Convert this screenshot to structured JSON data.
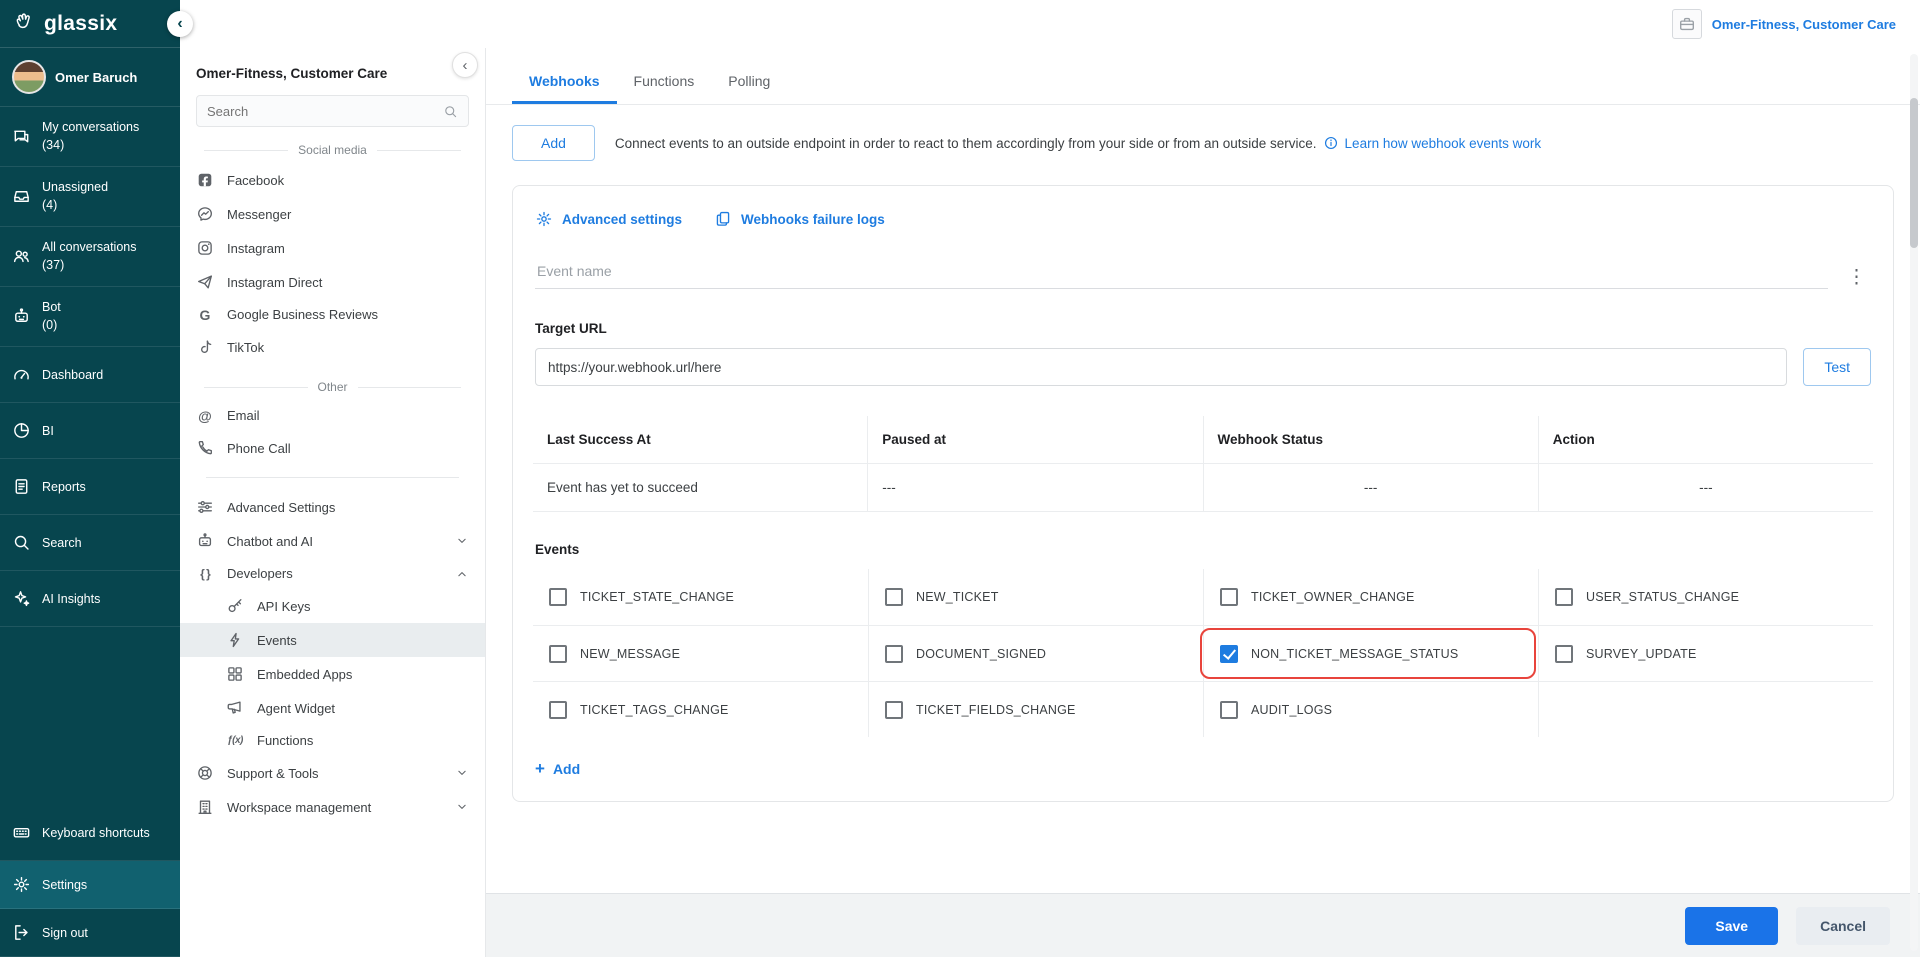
{
  "colors": {
    "teal_dark": "#07454e",
    "teal_active": "#11616f",
    "accent_blue": "#1e7ce0",
    "save_blue": "#1a73e8",
    "highlight_red": "#e8443c",
    "border_gray": "#e4e6e8"
  },
  "glyphs": {
    "plus": "+",
    "kebab": "⋮",
    "collapse": "‹",
    "google": "G",
    "email": "@",
    "code": "{ }",
    "function": "ƒ(x)"
  },
  "brand": {
    "logo_text": "glassix"
  },
  "top_bar": {
    "account_name": "Omer-Fitness, Customer Care"
  },
  "nav": {
    "user_name": "Omer Baruch",
    "items": [
      {
        "label": "My conversations",
        "count": "(34)",
        "icon": "chat-icon"
      },
      {
        "label": "Unassigned",
        "count": "(4)",
        "icon": "inbox-icon"
      },
      {
        "label": "All conversations",
        "count": "(37)",
        "icon": "people-icon"
      },
      {
        "label": "Bot",
        "count": "(0)",
        "icon": "bot-icon"
      },
      {
        "label": "Dashboard",
        "icon": "dashboard-icon"
      },
      {
        "label": "BI",
        "icon": "pie-chart-icon"
      },
      {
        "label": "Reports",
        "icon": "report-icon"
      },
      {
        "label": "Search",
        "icon": "search-icon"
      },
      {
        "label": "AI Insights",
        "icon": "sparkle-icon"
      }
    ],
    "bottom_items": [
      {
        "label": "Keyboard shortcuts",
        "icon": "keyboard-icon"
      },
      {
        "label": "Settings",
        "icon": "gear-icon",
        "active": true
      },
      {
        "label": "Sign out",
        "icon": "sign-out-icon"
      }
    ]
  },
  "settings_panel": {
    "title": "Omer-Fitness, Customer Care",
    "search_placeholder": "Search",
    "sections": {
      "social": "Social media",
      "other": "Other"
    },
    "social_items": [
      {
        "label": "Facebook",
        "icon": "facebook-icon"
      },
      {
        "label": "Messenger",
        "icon": "messenger-icon"
      },
      {
        "label": "Instagram",
        "icon": "instagram-icon"
      },
      {
        "label": "Instagram Direct",
        "icon": "instagram-direct-icon"
      },
      {
        "label": "Google Business Reviews",
        "icon": "google-icon"
      },
      {
        "label": "TikTok",
        "icon": "tiktok-icon"
      }
    ],
    "other_items": [
      {
        "label": "Email",
        "icon": "email-icon"
      },
      {
        "label": "Phone Call",
        "icon": "phone-icon"
      }
    ],
    "advanced_settings": "Advanced Settings",
    "groups": {
      "chatbot": "Chatbot and AI",
      "developers": "Developers",
      "support": "Support & Tools",
      "workspace": "Workspace management"
    },
    "developer_items": [
      {
        "label": "API Keys",
        "icon": "key-icon",
        "selected": false
      },
      {
        "label": "Events",
        "icon": "bolt-icon",
        "selected": true
      },
      {
        "label": "Embedded Apps",
        "icon": "grid-icon",
        "selected": false
      },
      {
        "label": "Agent Widget",
        "icon": "megaphone-icon",
        "selected": false
      },
      {
        "label": "Functions",
        "icon": "function-icon",
        "selected": false
      }
    ]
  },
  "main": {
    "tabs": [
      {
        "label": "Webhooks",
        "active": true
      },
      {
        "label": "Functions",
        "active": false
      },
      {
        "label": "Polling",
        "active": false
      }
    ],
    "add_button": "Add",
    "description": "Connect events to an outside endpoint in order to react to them accordingly from your side or from an outside service.",
    "learn_link": "Learn how webhook events work",
    "card": {
      "advanced_settings_link": "Advanced settings",
      "failure_logs_link": "Webhooks failure logs",
      "event_name_placeholder": "Event name",
      "target_url_label": "Target URL",
      "target_url_value": "https://your.webhook.url/here",
      "test_button": "Test",
      "table_headers": [
        "Last Success At",
        "Paused at",
        "Webhook Status",
        "Action"
      ],
      "table_row": [
        "Event has yet to succeed",
        "---",
        "---",
        "---"
      ],
      "events_label": "Events",
      "events": [
        {
          "label": "TICKET_STATE_CHANGE",
          "checked": false
        },
        {
          "label": "NEW_TICKET",
          "checked": false
        },
        {
          "label": "TICKET_OWNER_CHANGE",
          "checked": false
        },
        {
          "label": "USER_STATUS_CHANGE",
          "checked": false
        },
        {
          "label": "NEW_MESSAGE",
          "checked": false
        },
        {
          "label": "DOCUMENT_SIGNED",
          "checked": false
        },
        {
          "label": "NON_TICKET_MESSAGE_STATUS",
          "checked": true,
          "highlighted": true
        },
        {
          "label": "SURVEY_UPDATE",
          "checked": false
        },
        {
          "label": "TICKET_TAGS_CHANGE",
          "checked": false
        },
        {
          "label": "TICKET_FIELDS_CHANGE",
          "checked": false
        },
        {
          "label": "AUDIT_LOGS",
          "checked": false
        }
      ],
      "add_event_link": "Add"
    },
    "footer": {
      "save_button": "Save",
      "cancel_button": "Cancel"
    }
  }
}
